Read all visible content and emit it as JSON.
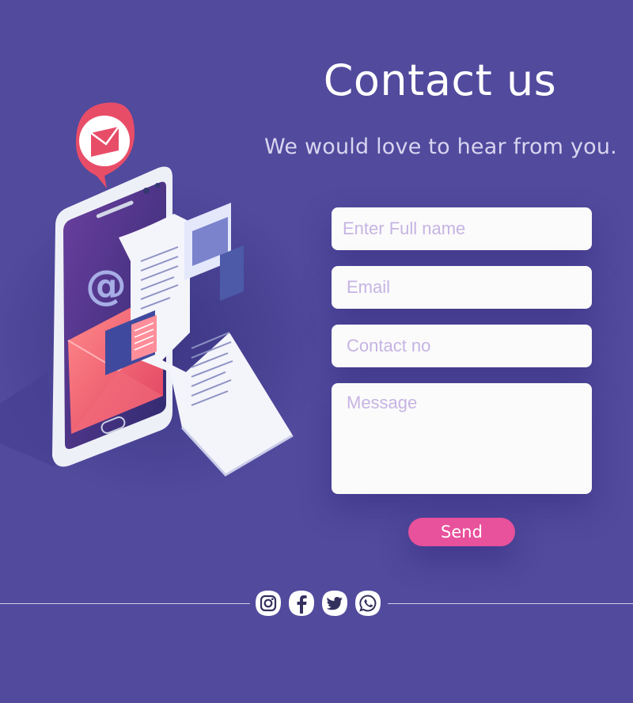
{
  "header": {
    "title": "Contact us",
    "subtitle": "We would love to hear from you."
  },
  "form": {
    "name_placeholder": "Enter Full name",
    "email_placeholder": "Email",
    "contact_placeholder": "Contact no",
    "message_placeholder": "Message",
    "send_label": "Send"
  },
  "illustration": {
    "at_symbol": "@"
  },
  "social": [
    "instagram-icon",
    "facebook-icon",
    "twitter-icon",
    "whatsapp-icon"
  ],
  "colors": {
    "background": "#514a9d",
    "accent": "#e8519b",
    "field_bg": "#fbfbfb",
    "placeholder": "#c6b4e3"
  }
}
